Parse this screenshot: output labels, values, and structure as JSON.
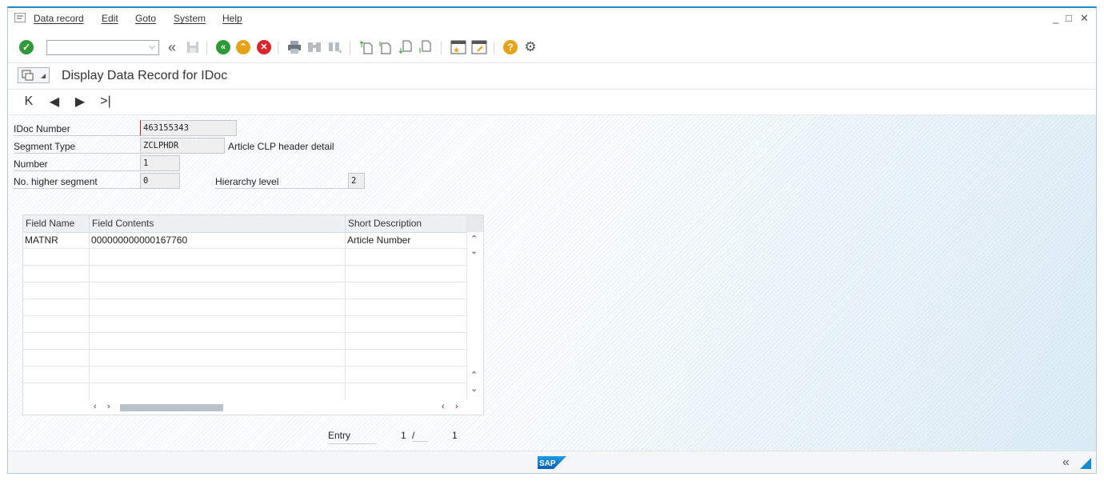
{
  "menubar": {
    "items": [
      "Data record",
      "Edit",
      "Goto",
      "System",
      "Help"
    ],
    "window_controls": [
      "_",
      "□",
      "✕"
    ]
  },
  "toolbar": {
    "command_field_value": "",
    "icons": [
      "enter-icon",
      "back-history-icon",
      "save-icon",
      "back-icon",
      "exit-icon",
      "cancel-icon",
      "print-icon",
      "find-icon",
      "find-next-icon",
      "first-page-icon",
      "previous-page-icon",
      "next-page-icon",
      "last-page-icon",
      "create-session-icon",
      "shortcut-icon",
      "help-icon",
      "customize-layout-icon"
    ],
    "colors": {
      "enter": "#2e9a3a",
      "back": "#2e9a3a",
      "exit": "#e6a21a",
      "cancel": "#d6252c",
      "help": "#e6a21a"
    }
  },
  "title": "Display Data Record for IDoc",
  "fields": {
    "idoc_number_label": "IDoc Number",
    "idoc_number_value": "463155343",
    "segment_type_label": "Segment Type",
    "segment_type_value": "ZCLPHDR",
    "segment_type_desc": "Article CLP header detail",
    "number_label": "Number",
    "number_value": "1",
    "higher_segment_label": "No. higher segment",
    "higher_segment_value": "0",
    "hierarchy_level_label": "Hierarchy level",
    "hierarchy_level_value": "2"
  },
  "table": {
    "headers": [
      "Field Name",
      "Field Contents",
      "Short Description"
    ],
    "rows": [
      [
        "MATNR",
        "000000000000167760",
        "Article Number"
      ]
    ]
  },
  "entry": {
    "label": "Entry",
    "current": "1",
    "separator": "/",
    "total": "1"
  },
  "status": {
    "logo_text": "SAP"
  }
}
